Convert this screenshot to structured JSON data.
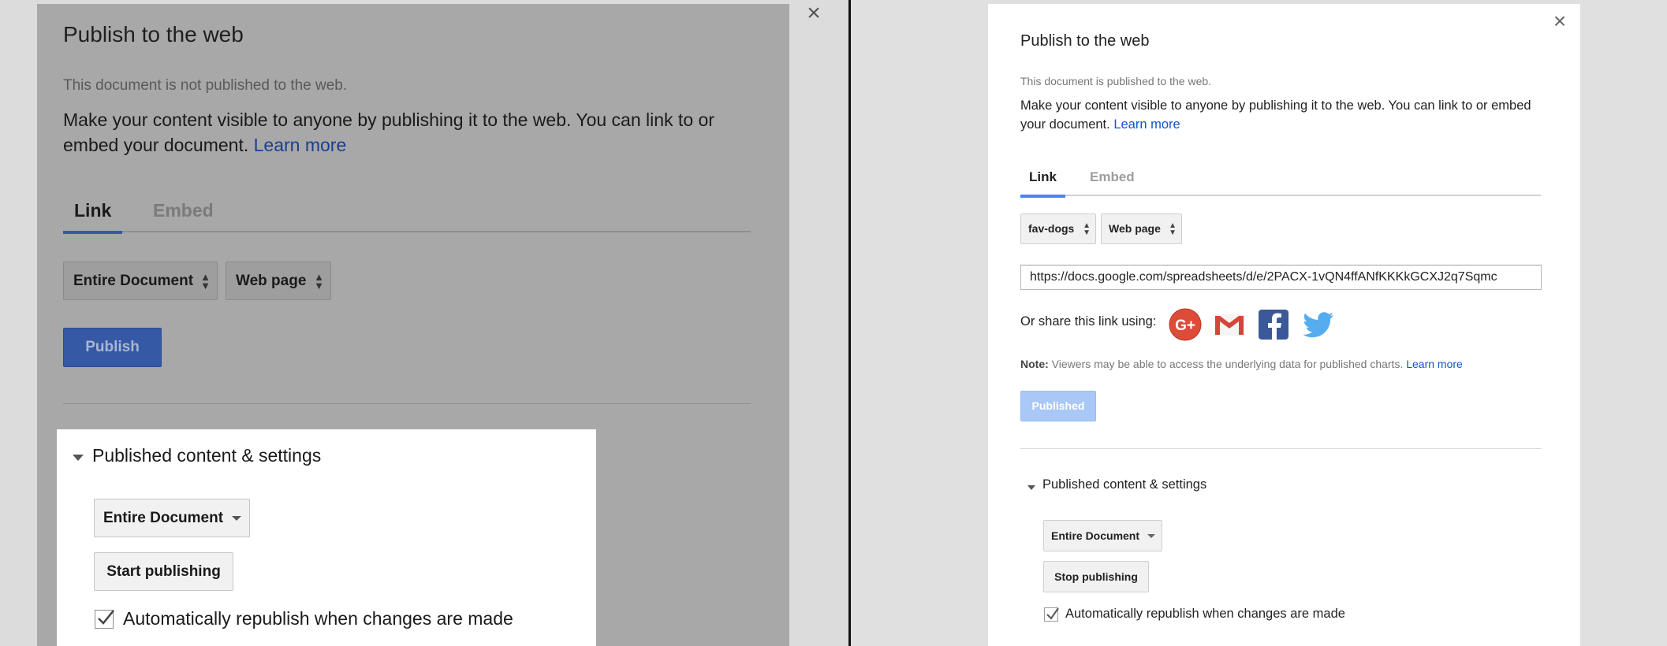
{
  "left": {
    "close_glyph": "×",
    "title": "Publish to the web",
    "status": "This document is not published to the web.",
    "description": "Make your content visible to anyone by publishing it to the web. You can link to or embed your document.",
    "learn_more": "Learn more",
    "tabs": [
      {
        "label": "Link",
        "active": true
      },
      {
        "label": "Embed",
        "active": false
      }
    ],
    "selects": {
      "scope": "Entire Document",
      "format": "Web page"
    },
    "publish_button": "Publish",
    "section_title": "Published content & settings",
    "section_dropdown": "Entire Document",
    "start_button": "Start publishing",
    "auto_republish_label": "Automatically republish when changes are made",
    "auto_republish_checked": true
  },
  "right": {
    "close_glyph": "×",
    "title": "Publish to the web",
    "status": "This document is published to the web.",
    "description": "Make your content visible to anyone by publishing it to the web. You can link to or embed your document.",
    "learn_more": "Learn more",
    "tabs": [
      {
        "label": "Link",
        "active": true
      },
      {
        "label": "Embed",
        "active": false
      }
    ],
    "selects": {
      "sheet": "fav-dogs",
      "format": "Web page"
    },
    "published_url": "https://docs.google.com/spreadsheets/d/e/2PACX-1vQN4ffANfKKKkGCXJ2q7Sqmc",
    "share_label": "Or share this link using:",
    "share_targets": [
      {
        "name": "google-plus",
        "glyph": "G+",
        "color": "#dd4b39"
      },
      {
        "name": "gmail",
        "glyph": "M",
        "color": "#d44638"
      },
      {
        "name": "facebook",
        "glyph": "f",
        "color": "#3b5998"
      },
      {
        "name": "twitter",
        "color": "#55acee"
      }
    ],
    "note_label": "Note:",
    "note_text": "Viewers may be able to access the underlying data for published charts.",
    "note_learn_more": "Learn more",
    "published_button": "Published",
    "section_title": "Published content & settings",
    "section_dropdown": "Entire Document",
    "stop_button": "Stop publishing",
    "auto_republish_label": "Automatically republish when changes are made",
    "auto_republish_checked": true
  }
}
